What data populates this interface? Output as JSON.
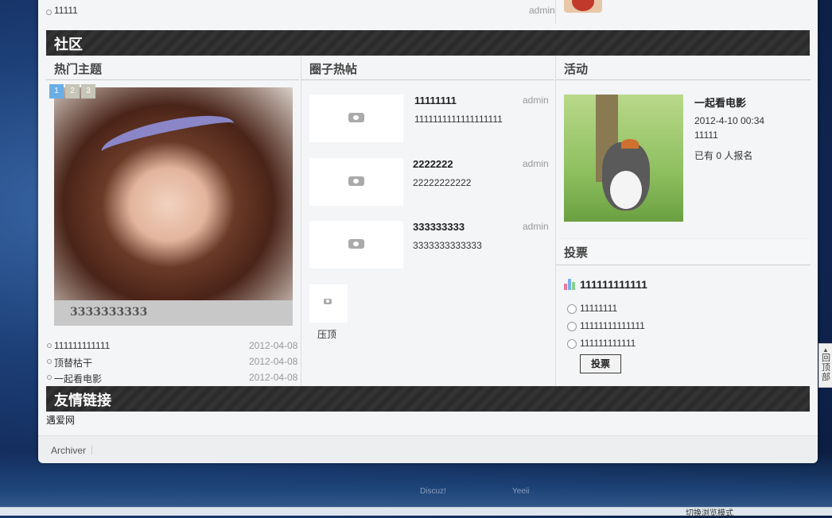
{
  "top_row": {
    "title": "11111",
    "author": "admin"
  },
  "sections": {
    "community": "社区",
    "friend_links": "友情链接"
  },
  "hot_topics": {
    "heading": "热门主题",
    "pager": [
      "1",
      "2",
      "3"
    ],
    "slide_caption": "3333333333",
    "items": [
      {
        "title": "111111111111",
        "date": "2012-04-08"
      },
      {
        "title": "顶替枯干",
        "date": "2012-04-08"
      },
      {
        "title": "一起看电影",
        "date": "2012-04-08"
      }
    ]
  },
  "circle_posts": {
    "heading": "圈子热帖",
    "posts": [
      {
        "title": "11111111",
        "author": "admin",
        "content": "1111111111111111111"
      },
      {
        "title": "2222222",
        "author": "admin",
        "content": "22222222222"
      },
      {
        "title": "333333333",
        "author": "admin",
        "content": "3333333333333"
      }
    ],
    "pinned_label": "压顶"
  },
  "activity": {
    "heading": "活动",
    "title": "一起看电影",
    "date": "2012-4-10 00:34",
    "place": "11111",
    "signup_prefix": "已有",
    "signup_count": "0",
    "signup_suffix": "人报名"
  },
  "poll": {
    "heading": "投票",
    "question": "111111111111",
    "options": [
      "11111111",
      "11111111111111",
      "111111111111"
    ],
    "vote_label": "投票"
  },
  "friend_links": {
    "items": [
      "遇爱网"
    ]
  },
  "footer": {
    "archiver": "Archiver"
  },
  "credits": {
    "left": "Discuz!",
    "right": "Yeeii"
  },
  "back_to_top": "回顶部",
  "statusbar": {
    "text": "切换浏览模式"
  }
}
